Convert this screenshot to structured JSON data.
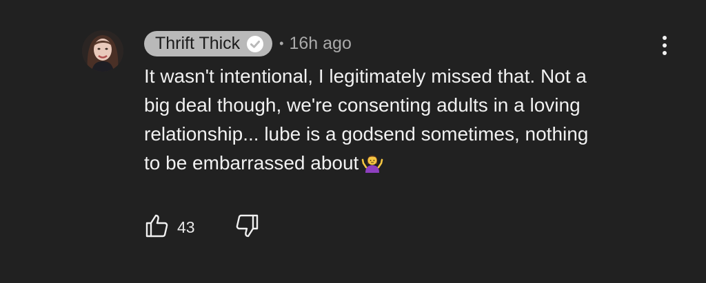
{
  "comment": {
    "author": "Thrift Thick",
    "verified_icon": "verified-check-icon",
    "separator": "•",
    "timestamp": "16h ago",
    "text_lines": [
      "It wasn't intentional, I legitimately missed that. Not a",
      "big deal though, we're consenting adults in a loving",
      "relationship... lube is a godsend sometimes, nothing",
      "to be embarrassed about"
    ],
    "emoji": "shrug-emoji",
    "like_count": "43",
    "icons": {
      "like": "thumbs-up-icon",
      "dislike": "thumbs-down-icon",
      "menu": "more-vert-icon"
    }
  }
}
